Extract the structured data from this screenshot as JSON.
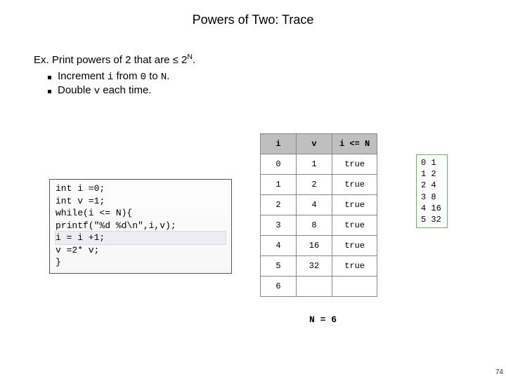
{
  "title": "Powers of Two:  Trace",
  "ex": {
    "label": "Ex.",
    "text_before_le": "  Print powers of 2 that are ",
    "le_sym": "≤",
    "two": " 2",
    "exp": "N",
    "text_after": "."
  },
  "bullets": [
    {
      "pre": "Increment ",
      "m1": "i",
      "mid": " from ",
      "m2": "0",
      "mid2": " to ",
      "m3": "N",
      "post": "."
    },
    {
      "pre": "Double ",
      "m1": "v",
      "post": " each time."
    }
  ],
  "code": {
    "l1": "int i =0;",
    "l2": "int v =1;",
    "l3": "while(i <= N){",
    "l4": "printf(\"%d %d\\n\",i,v);",
    "l5": "   i = i +1;",
    "l6": "v =2* v;",
    "l7": "}"
  },
  "table": {
    "headers": [
      "i",
      "v",
      "i <= N"
    ],
    "rows": [
      [
        "0",
        "1",
        "true"
      ],
      [
        "1",
        "2",
        "true"
      ],
      [
        "2",
        "4",
        "true"
      ],
      [
        "3",
        "8",
        "true"
      ],
      [
        "4",
        "16",
        "true"
      ],
      [
        "5",
        "32",
        "true"
      ],
      [
        "6",
        "",
        ""
      ]
    ]
  },
  "output_lines": [
    "0 1",
    "1 2",
    "2 4",
    "3 8",
    "4 16",
    "5 32"
  ],
  "n_label": "N = 6",
  "page_number": "74"
}
